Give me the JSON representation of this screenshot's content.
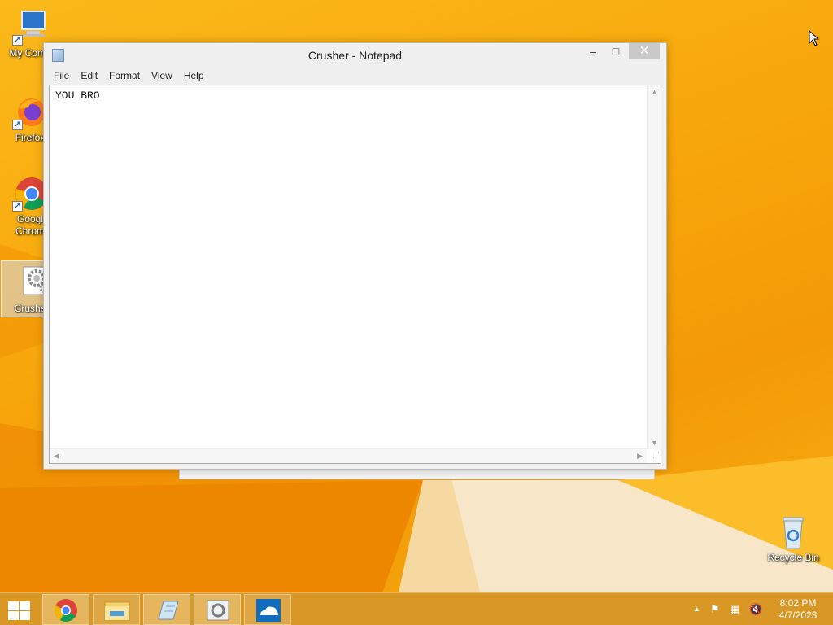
{
  "desktop": {
    "icons": [
      {
        "label": "My Comp",
        "icon": "computer-icon"
      },
      {
        "label": "Firefox",
        "icon": "firefox-icon"
      },
      {
        "label": "Googl\nChrom",
        "icon": "chrome-icon"
      },
      {
        "label": "Crushe",
        "icon": "crusher-icon"
      },
      {
        "label": "Recycle Bin",
        "icon": "recycle-bin-icon"
      }
    ]
  },
  "window": {
    "title": "Crusher - Notepad",
    "controls": {
      "minimize": "–",
      "maximize": "□",
      "close": "✕"
    },
    "menu": [
      "File",
      "Edit",
      "Format",
      "View",
      "Help"
    ],
    "content": "YOU BRO"
  },
  "taskbar": {
    "pinned": [
      "chrome-icon",
      "file-explorer-icon",
      "notepad-icon",
      "crusher-icon",
      "onedrive-icon"
    ],
    "tray": [
      "show-hidden-icons",
      "action-center-flag-icon",
      "network-icon",
      "volume-muted-icon"
    ],
    "clock": {
      "time": "8:02 PM",
      "date": "4/7/2023"
    }
  },
  "colors": {
    "wallpaper": "#f8a80c",
    "taskbar": "#d6962a",
    "close_button": "#c9c9c9"
  }
}
